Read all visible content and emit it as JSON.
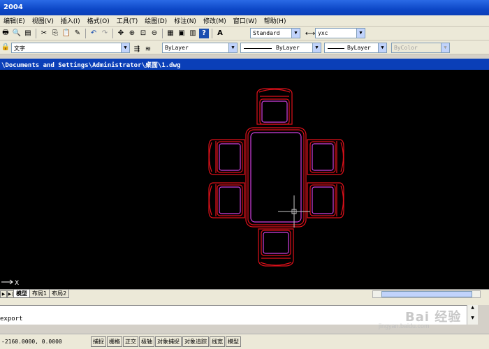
{
  "app": {
    "title": "2004"
  },
  "menu": {
    "items": [
      "编辑(E)",
      "视图(V)",
      "插入(I)",
      "格式(O)",
      "工具(T)",
      "绘图(D)",
      "标注(N)",
      "修改(M)",
      "窗口(W)",
      "帮助(H)"
    ]
  },
  "toolbar": {
    "text_style": "Standard",
    "dim_style": "yxc",
    "layer": "文字",
    "color": "ByLayer",
    "linetype": "ByLayer",
    "lineweight": "ByLayer",
    "plot_style": "ByColor"
  },
  "drawing": {
    "path": "\\Documents and Settings\\Administrator\\桌面\\1.dwg"
  },
  "layout_tabs": [
    "模型",
    "布局1",
    "布局2"
  ],
  "ucs": {
    "x_label": "X"
  },
  "command": {
    "text": "export"
  },
  "status": {
    "coords": "-2160.0000, 0.0000",
    "buttons": [
      "捕捉",
      "栅格",
      "正交",
      "极轴",
      "对象捕捉",
      "对象追踪",
      "线宽",
      "模型"
    ]
  },
  "watermark": {
    "brand": "Bai 经验",
    "sub": "jingyan.baidu.com"
  },
  "colors": {
    "canvas_bg": "#000000",
    "furniture_red": "#e0101a",
    "cushion_magenta": "#d040e0",
    "title_blue": "#0a3fb8"
  }
}
